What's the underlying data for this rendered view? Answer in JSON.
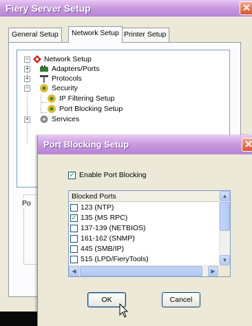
{
  "window": {
    "title": "Fiery Server Setup",
    "close_glyph": "✕",
    "tabs": [
      {
        "label": "General Setup"
      },
      {
        "label": "Network Setup"
      },
      {
        "label": "Printer Setup"
      }
    ],
    "active_tab": "Network Setup"
  },
  "tree": {
    "root": "Network Setup",
    "items": [
      {
        "label": "Adapters/Ports",
        "icon": "network-adapter-icon",
        "expander": "+"
      },
      {
        "label": "Protocols",
        "icon": "protocols-icon",
        "expander": "+"
      },
      {
        "label": "Security",
        "icon": "security-icon",
        "expander": "−"
      },
      {
        "label": "IP Filtering Setup",
        "icon": "security-icon"
      },
      {
        "label": "Port Blocking Setup",
        "icon": "security-icon"
      },
      {
        "label": "Services",
        "icon": "services-icon",
        "expander": "+"
      }
    ],
    "root_expander": "−"
  },
  "partial_group_label": "Po",
  "dialog": {
    "title": "Port Blocking Setup",
    "enable_label": "Enable Port Blocking",
    "enable_checked": true,
    "list_header": "Blocked Ports",
    "ports": [
      {
        "label": "123 (NTP)",
        "checked": false
      },
      {
        "label": "135 (MS RPC)",
        "checked": true
      },
      {
        "label": "137-139 (NETBIOS)",
        "checked": false
      },
      {
        "label": "161-162 (SNMP)",
        "checked": false
      },
      {
        "label": "445 (SMB/IP)",
        "checked": false
      },
      {
        "label": "515 (LPD/FieryTools)",
        "checked": false
      }
    ],
    "ok_label": "OK",
    "cancel_label": "Cancel",
    "check_glyph": "✓",
    "scroll_up": "▲",
    "scroll_down": "▼",
    "scroll_left": "◀",
    "scroll_right": "▶"
  },
  "colors": {
    "titlebar": "#c99be0",
    "dialog_bg": "#ece9d8",
    "close_button": "#d8562f"
  }
}
